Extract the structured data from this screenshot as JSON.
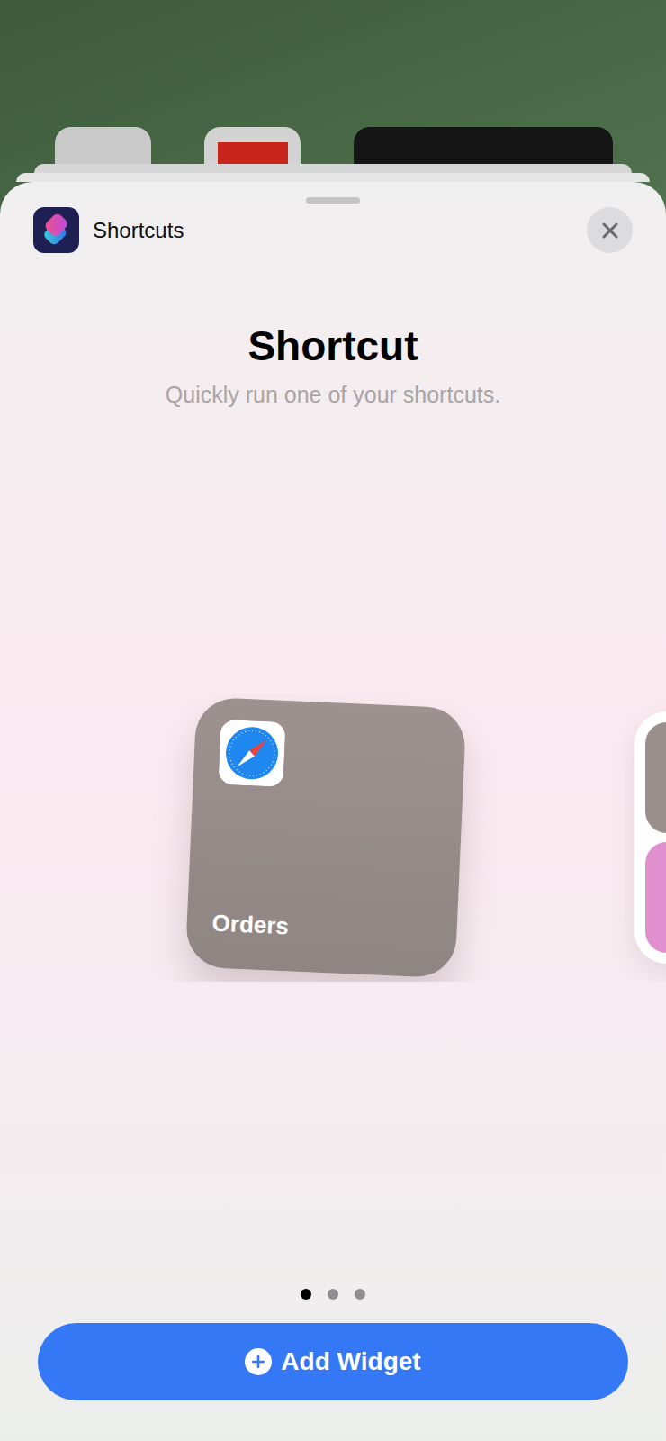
{
  "app": {
    "name": "Shortcuts"
  },
  "widget_type": {
    "title": "Shortcut",
    "description": "Quickly run one of your shortcuts."
  },
  "widget": {
    "label": "Orders"
  },
  "pages": [
    {
      "selected": true
    },
    {
      "selected": false
    },
    {
      "selected": false
    }
  ],
  "button": {
    "label": "Add Widget"
  }
}
